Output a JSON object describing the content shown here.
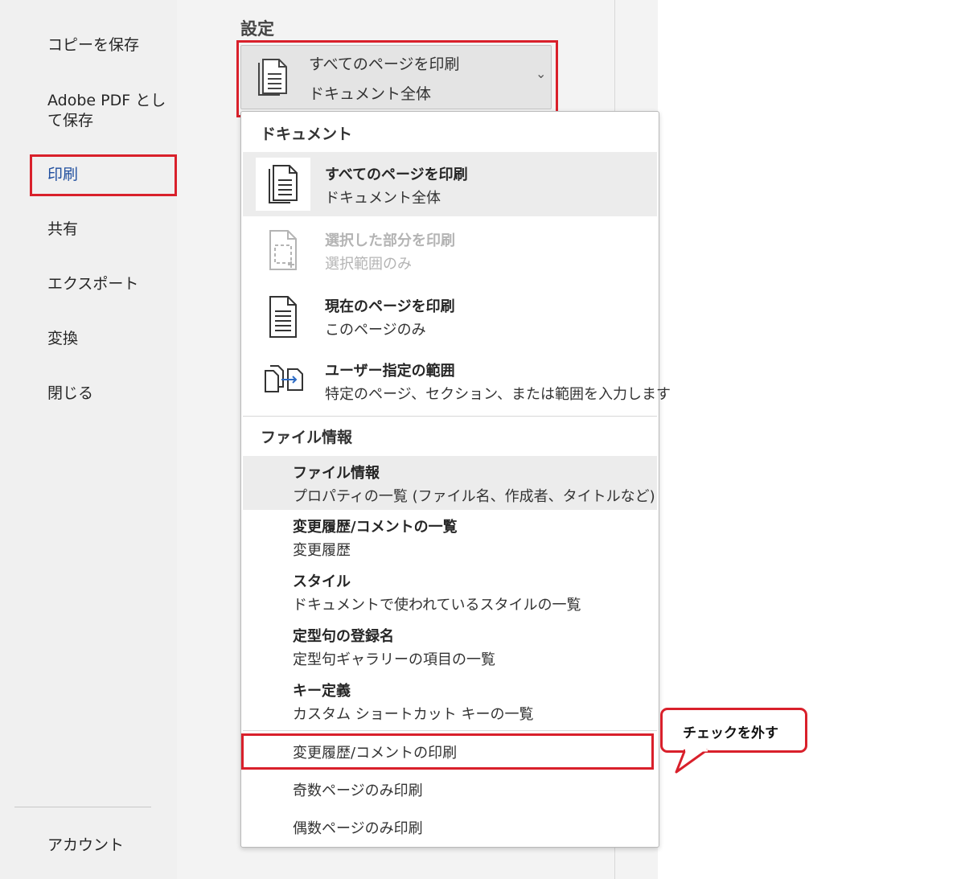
{
  "nav": {
    "items": [
      {
        "label": "コピーを保存"
      },
      {
        "label": "Adobe PDF とし"
      },
      {
        "label": "て保存"
      },
      {
        "label": "印刷"
      },
      {
        "label": "共有"
      },
      {
        "label": "エクスポート"
      },
      {
        "label": "変換"
      },
      {
        "label": "閉じる"
      }
    ],
    "account": "アカウント"
  },
  "settings": {
    "title": "設定",
    "dropdown": {
      "line1": "すべてのページを印刷",
      "line2": "ドキュメント全体",
      "chevron": "⌄",
      "icon": "document-pages-icon"
    }
  },
  "menu": {
    "section_document": "ドキュメント",
    "items": [
      {
        "title": "すべてのページを印刷",
        "desc": "ドキュメント全体",
        "icon": "document-pages-icon"
      },
      {
        "title": "選択した部分を印刷",
        "desc": "選択範囲のみ",
        "icon": "selection-page-icon"
      },
      {
        "title": "現在のページを印刷",
        "desc": "このページのみ",
        "icon": "single-page-icon"
      },
      {
        "title": "ユーザー指定の範囲",
        "desc": "特定のページ、セクション、または範囲を入力します",
        "icon": "custom-range-icon"
      }
    ],
    "section_fileinfo": "ファイル情報",
    "info_items": [
      {
        "title": "ファイル情報",
        "desc": "プロパティの一覧 (ファイル名、作成者、タイトルなど)"
      },
      {
        "title": "変更履歴/コメントの一覧",
        "desc": "変更履歴"
      },
      {
        "title": "スタイル",
        "desc": "ドキュメントで使われているスタイルの一覧"
      },
      {
        "title": "定型句の登録名",
        "desc": "定型句ギャラリーの項目の一覧"
      },
      {
        "title": "キー定義",
        "desc": "カスタム ショートカット キーの一覧"
      }
    ],
    "options": [
      {
        "label": "変更履歴/コメントの印刷"
      },
      {
        "label": "奇数ページのみ印刷"
      },
      {
        "label": "偶数ページのみ印刷"
      }
    ]
  },
  "callout": {
    "text": "チェックを外す"
  },
  "colors": {
    "highlight": "#d9202b",
    "active_nav": "#1f4e9e"
  }
}
